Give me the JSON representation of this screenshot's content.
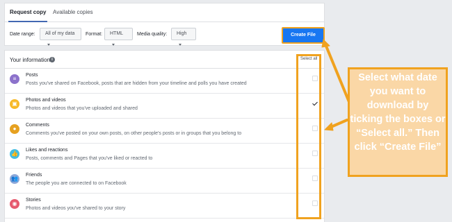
{
  "tabs": [
    {
      "label": "Request copy"
    },
    {
      "label": "Available copies"
    }
  ],
  "options": {
    "date_range_label": "Date range:",
    "date_range_value": "All of my data",
    "format_label": "Format:",
    "format_value": "HTML",
    "media_quality_label": "Media quality:",
    "media_quality_value": "High"
  },
  "create_button_label": "Create File",
  "info": {
    "title": "Your information",
    "info_icon_glyph": "i",
    "select_all": "Select all"
  },
  "rows": [
    {
      "title": "Posts",
      "desc": "Posts you've shared on Facebook, posts that are hidden from your timeline and polls you have created",
      "checked": false,
      "icon": "posts-icon",
      "color": "#8c72cb"
    },
    {
      "title": "Photos and videos",
      "desc": "Photos and videos that you've uploaded and shared",
      "checked": true,
      "icon": "photos-icon",
      "color": "#f7b928"
    },
    {
      "title": "Comments",
      "desc": "Comments you've posted on your own posts, on other people's posts or in groups that you belong to",
      "checked": false,
      "icon": "comments-icon",
      "color": "#e6a120"
    },
    {
      "title": "Likes and reactions",
      "desc": "Posts, comments and Pages that you've liked or reacted to",
      "checked": false,
      "icon": "like-icon",
      "color": "#45bde0"
    },
    {
      "title": "Friends",
      "desc": "The people you are connected to on Facebook",
      "checked": false,
      "icon": "friends-icon",
      "color": "#8ca8d9"
    },
    {
      "title": "Stories",
      "desc": "Photos and videos you've shared to your story",
      "checked": false,
      "icon": "stories-icon",
      "color": "#e65a6e"
    }
  ],
  "callout_text": "Select what date you want to download by ticking the boxes or “Select all.” Then click “Create File”",
  "colors": {
    "accent": "#1877f2",
    "highlight": "#f0a21f",
    "callout_bg": "#fad7a6"
  }
}
